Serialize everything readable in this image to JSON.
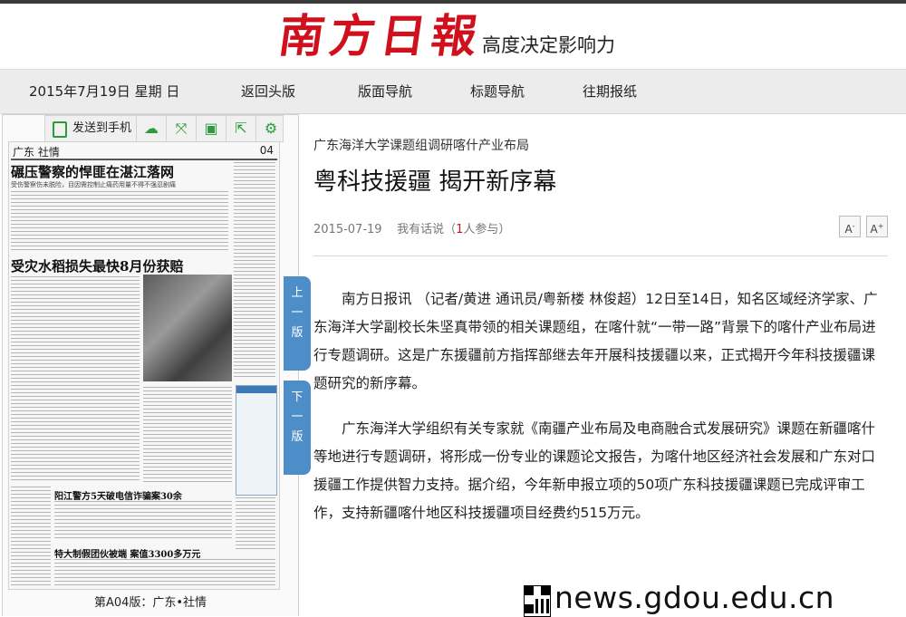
{
  "masthead": {
    "logo_text": "南方日報",
    "slogan": "高度决定影响力"
  },
  "nav": {
    "date": "2015年7月19日 星期 日",
    "items": [
      "返回头版",
      "版面导航",
      "标题导航",
      "往期报纸"
    ]
  },
  "toolbar": {
    "send_label": "发送到手机",
    "icons": [
      "cloud-icon",
      "expand-icon",
      "save-icon",
      "share-icon",
      "gear-icon"
    ],
    "accent_color": "#2a9d3a"
  },
  "paper": {
    "section": "广东  社情",
    "page_no": "04",
    "headline1": "碾压警察的悍匪在湛江落网",
    "sub1": "受伤警察伤未脱险，目因需控制止痛药用量不得不强忍剧痛",
    "headline2": "受灾水稻损失最快8月份获赔",
    "headline3": "阳江警方5天破电信诈骗案30余",
    "headline4": "特大制假团伙被端 案值3300多万元",
    "caption": "第A04版：广东•社情"
  },
  "pager": {
    "prev": [
      "上",
      "一",
      "版"
    ],
    "next": [
      "下",
      "一",
      "版"
    ],
    "color": "#4d8ec9"
  },
  "article": {
    "kicker": "广东海洋大学课题组调研喀什产业布局",
    "title": "粤科技援疆 揭开新序幕",
    "date": "2015-07-19",
    "comment_prefix": "我有话说（",
    "comment_count": "1",
    "comment_suffix": "人参与）",
    "font_smaller": "A",
    "font_larger": "A",
    "paragraphs": [
      "南方日报讯 （记者/黄进 通讯员/粤新楼 林俊超）12日至14日，知名区域经济学家、广东海洋大学副校长朱坚真带领的相关课题组，在喀什就“一带一路”背景下的喀什产业布局进行专题调研。这是广东援疆前方指挥部继去年开展科技援疆以来，正式揭开今年科技援疆课题研究的新序幕。",
      "广东海洋大学组织有关专家就《南疆产业布局及电商融合式发展研究》课题在新疆喀什等地进行专题调研，将形成一份专业的课题论文报告，为喀什地区经济社会发展和广东对口援疆工作提供智力支持。据介绍，今年新申报立项的50项广东科技援疆课题已完成评审工作，支持新疆喀什地区科技援疆项目经费约515万元。"
    ]
  },
  "watermark": "news.gdou.edu.cn",
  "colors": {
    "brand_red": "#d0101c",
    "nav_bg": "#ececec"
  }
}
